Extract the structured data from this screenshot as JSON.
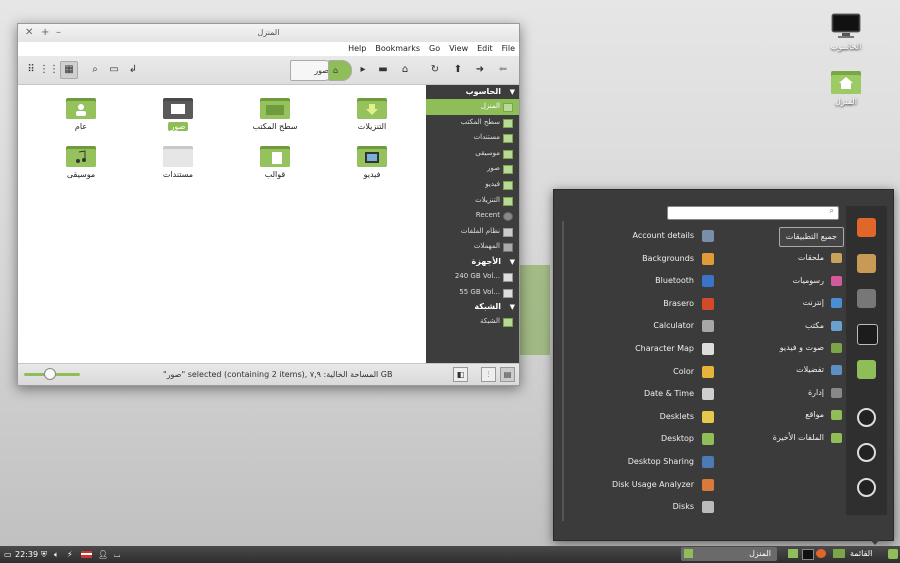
{
  "desktop": {
    "icons": [
      {
        "label": "الحاسوب",
        "icon": "monitor-icon"
      },
      {
        "label": "المنزل",
        "icon": "home-folder-icon"
      }
    ]
  },
  "file_manager": {
    "title": "المنزل",
    "menu": [
      "Help",
      "Bookmarks",
      "Go",
      "View",
      "Edit",
      "File"
    ],
    "breadcrumbs": [
      "صور",
      ""
    ],
    "files": [
      {
        "label": "عام"
      },
      {
        "label": "",
        "badge": "صور"
      },
      {
        "label": "سطح المكتب"
      },
      {
        "label": "التنزيلات"
      },
      {
        "label": "موسيقى"
      },
      {
        "label": "مستندات"
      },
      {
        "label": "قوالب"
      },
      {
        "label": "فيديو"
      }
    ],
    "sidebar": {
      "computer_heading": "الحاسوب",
      "computer_items": [
        "المنزل",
        "سطح المكتب",
        "مستندات",
        "موسيقى",
        "صور",
        "فيديو",
        "التنزيلات",
        "Recent",
        "نظام الملفات",
        "المهملات"
      ],
      "devices_heading": "الأجهزة",
      "devices_items": [
        "240 GB Vol...",
        "55 GB Vol..."
      ],
      "network_heading": "الشبكة",
      "network_items": [
        "الشبكة"
      ]
    },
    "status": "\"صور\" selected (containing 2 items), المساحة الخالية: ٧,٩ GB",
    "zoom_fraction": 0.45
  },
  "menu": {
    "search_placeholder": "",
    "categories": [
      {
        "label": "جميع التطبيقات",
        "color": ""
      },
      {
        "label": "ملحقات",
        "color": "#c9a25a"
      },
      {
        "label": "رسوميات",
        "color": "#d35b9a"
      },
      {
        "label": "إنترنت",
        "color": "#4a8fd4"
      },
      {
        "label": "مكتب",
        "color": "#6aa0d0"
      },
      {
        "label": "صوت و فيديو",
        "color": "#7aa647"
      },
      {
        "label": "تفضيلات",
        "color": "#5d8fc2"
      },
      {
        "label": "إدارة",
        "color": "#888888"
      },
      {
        "label": "مواقع",
        "color": "#8fbe58"
      },
      {
        "label": "الملفات الأخيرة",
        "color": "#8fbe58"
      }
    ],
    "apps": [
      {
        "label": "Account details",
        "color": "#7a8ea8"
      },
      {
        "label": "Backgrounds",
        "color": "#e09a3a"
      },
      {
        "label": "Bluetooth",
        "color": "#3b73c8"
      },
      {
        "label": "Brasero",
        "color": "#d34a2a"
      },
      {
        "label": "Calculator",
        "color": "#a7a7a7"
      },
      {
        "label": "Character Map",
        "color": "#dddddd"
      },
      {
        "label": "Color",
        "color": "#e8b33a"
      },
      {
        "label": "Date & Time",
        "color": "#cfcfcf"
      },
      {
        "label": "Desklets",
        "color": "#e6c94a"
      },
      {
        "label": "Desktop",
        "color": "#8fbe58"
      },
      {
        "label": "Desktop Sharing",
        "color": "#4a7bb5"
      },
      {
        "label": "Disk Usage Analyzer",
        "color": "#d77a3a"
      },
      {
        "label": "Disks",
        "color": "#bbbbbb"
      }
    ],
    "favorites": [
      {
        "icon": "firefox-icon",
        "color": "#e0662a"
      },
      {
        "icon": "package-icon",
        "color": "#c79a56"
      },
      {
        "icon": "settings-icon",
        "color": "#777777"
      },
      {
        "icon": "terminal-icon",
        "color": "#1c1c1c"
      },
      {
        "icon": "folder-icon",
        "color": "#8fbe58"
      },
      {
        "icon": "lock-icon",
        "color": "#222222"
      },
      {
        "icon": "logout-icon",
        "color": "#222222"
      },
      {
        "icon": "shutdown-icon",
        "color": "#222222"
      }
    ]
  },
  "taskbar": {
    "menu_label": "القائمة",
    "window_label": "المنزل",
    "clock": "22:39"
  }
}
